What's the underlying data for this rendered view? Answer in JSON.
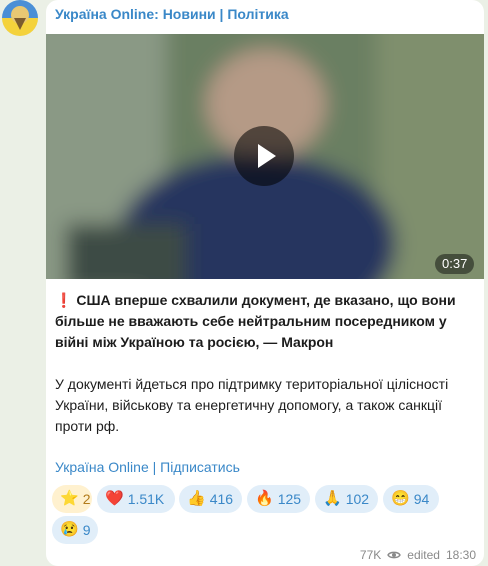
{
  "channel": {
    "title": "Україна Online: Новини | Політика"
  },
  "video": {
    "duration": "0:37",
    "play_icon": "play-icon"
  },
  "post": {
    "exclaim_icon": "❗",
    "headline": "США вперше схвалили документ, де вказано, що вони більше не вважають себе нейтральним посередником у війні між Україною та росією, — Макрон",
    "body": "У документі йдеться про підтримку територіальної цілісності України, військову та енергетичну допомогу, а також санкції проти рф.",
    "subscribe_link": "Україна Online | Підписатись"
  },
  "reactions": [
    {
      "emoji": "⭐",
      "count": "2",
      "icon": "star-icon"
    },
    {
      "emoji": "❤️",
      "count": "1.51K",
      "icon": "heart-icon"
    },
    {
      "emoji": "👍",
      "count": "416",
      "icon": "thumbs-up-icon"
    },
    {
      "emoji": "🔥",
      "count": "125",
      "icon": "fire-icon"
    },
    {
      "emoji": "🙏",
      "count": "102",
      "icon": "pray-icon"
    },
    {
      "emoji": "😁",
      "count": "94",
      "icon": "grin-icon"
    },
    {
      "emoji": "😢",
      "count": "9",
      "icon": "cry-icon"
    }
  ],
  "meta": {
    "views": "77K",
    "edited": "edited",
    "time": "18:30"
  }
}
